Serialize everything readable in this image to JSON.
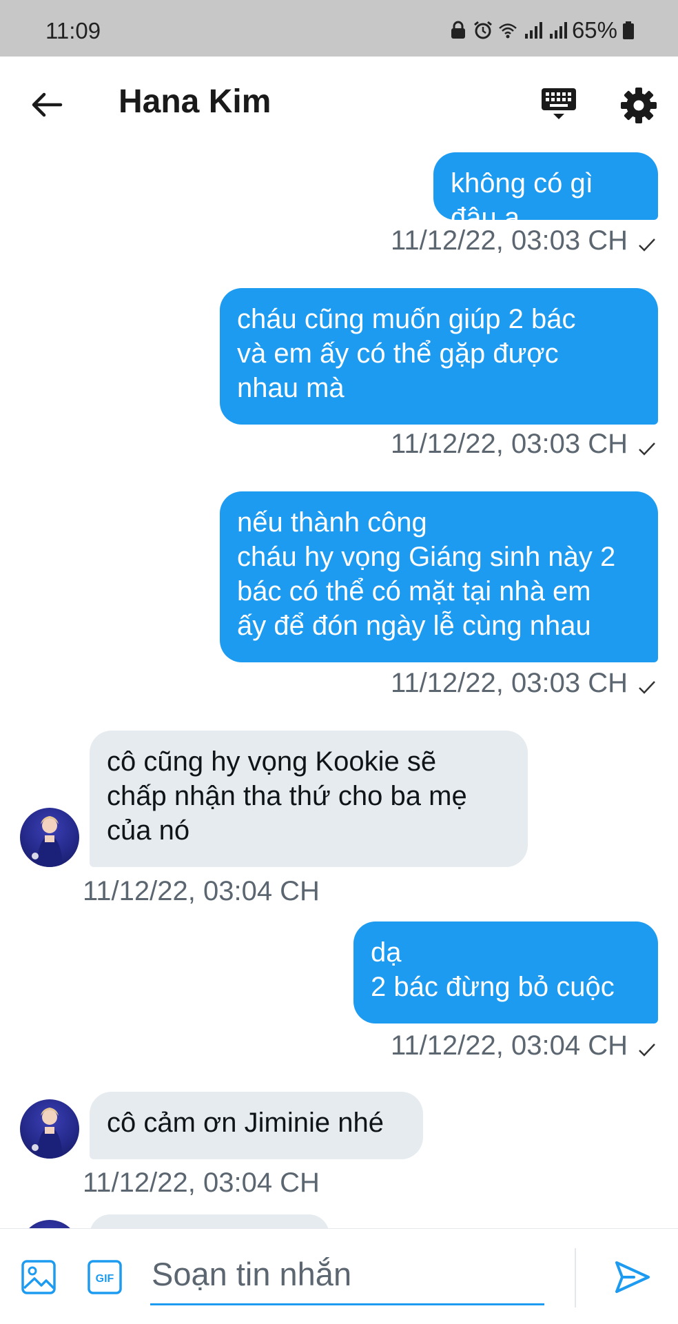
{
  "status_bar": {
    "time": "11:09",
    "battery": "65%",
    "icons": [
      "lock-icon",
      "alarm-icon",
      "wifi-icon",
      "signal-icon",
      "signal-icon",
      "battery-icon"
    ]
  },
  "header": {
    "title": "Hana Kim",
    "icons": [
      "back-arrow-icon",
      "keyboard-icon",
      "gear-icon"
    ]
  },
  "messages": [
    {
      "direction": "outgoing",
      "text": "không có gì đâu ạ",
      "timestamp": "11/12/22, 03:03 CH",
      "status": "sent"
    },
    {
      "direction": "outgoing",
      "text": "cháu cũng muốn giúp 2 bác\nvà em ấy có thể gặp được\nnhau mà",
      "timestamp": "11/12/22, 03:03 CH",
      "status": "sent"
    },
    {
      "direction": "outgoing",
      "text": "nếu thành công\ncháu hy vọng Giáng sinh này 2\nbác có thể có mặt tại nhà em\nấy để đón ngày lễ cùng nhau",
      "timestamp": "11/12/22, 03:03 CH",
      "status": "sent"
    },
    {
      "direction": "incoming",
      "text": "cô cũng hy vọng Kookie sẽ\nchấp nhận tha thứ cho ba mẹ\ncủa nó",
      "timestamp": "11/12/22, 03:04 CH"
    },
    {
      "direction": "outgoing",
      "text": "dạ\n2 bác đừng bỏ cuộc",
      "timestamp": "11/12/22, 03:04 CH",
      "status": "sent"
    },
    {
      "direction": "incoming",
      "text": "cô cảm ơn Jiminie nhé",
      "timestamp": "11/12/22, 03:04 CH"
    }
  ],
  "composer": {
    "placeholder": "Soạn tin nhắn",
    "value": "",
    "icons": [
      "image-icon",
      "gif-icon",
      "send-icon"
    ]
  },
  "colors": {
    "accent": "#1d9bf0",
    "incoming_bubble": "#e6ebef",
    "timestamp": "#5b6670",
    "status_bar": "#c7c7c7"
  }
}
